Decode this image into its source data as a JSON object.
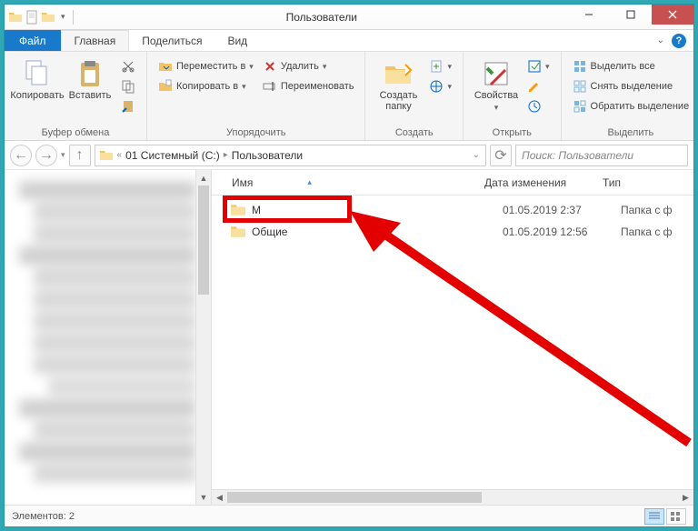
{
  "window": {
    "title": "Пользователи"
  },
  "menubar": {
    "file": "Файл",
    "tabs": [
      "Главная",
      "Поделиться",
      "Вид"
    ]
  },
  "ribbon": {
    "clipboard": {
      "label": "Буфер обмена",
      "copy": "Копировать",
      "paste": "Вставить"
    },
    "organize": {
      "label": "Упорядочить",
      "move_to": "Переместить в",
      "copy_to": "Копировать в",
      "delete": "Удалить",
      "rename": "Переименовать"
    },
    "create": {
      "label": "Создать",
      "new_folder": "Создать\nпапку"
    },
    "open": {
      "label": "Открыть",
      "properties": "Свойства"
    },
    "select": {
      "label": "Выделить",
      "select_all": "Выделить все",
      "select_none": "Снять выделение",
      "invert": "Обратить выделение"
    }
  },
  "breadcrumb": {
    "items": [
      "01 Системный (C:)",
      "Пользователи"
    ]
  },
  "search": {
    "placeholder": "Поиск: Пользователи"
  },
  "columns": {
    "name": "Имя",
    "date": "Дата изменения",
    "type": "Тип"
  },
  "files": [
    {
      "name": "M",
      "date": "01.05.2019 2:37",
      "type": "Папка с ф"
    },
    {
      "name": "Общие",
      "date": "01.05.2019 12:56",
      "type": "Папка с ф"
    }
  ],
  "status": {
    "count": "Элементов: 2"
  }
}
